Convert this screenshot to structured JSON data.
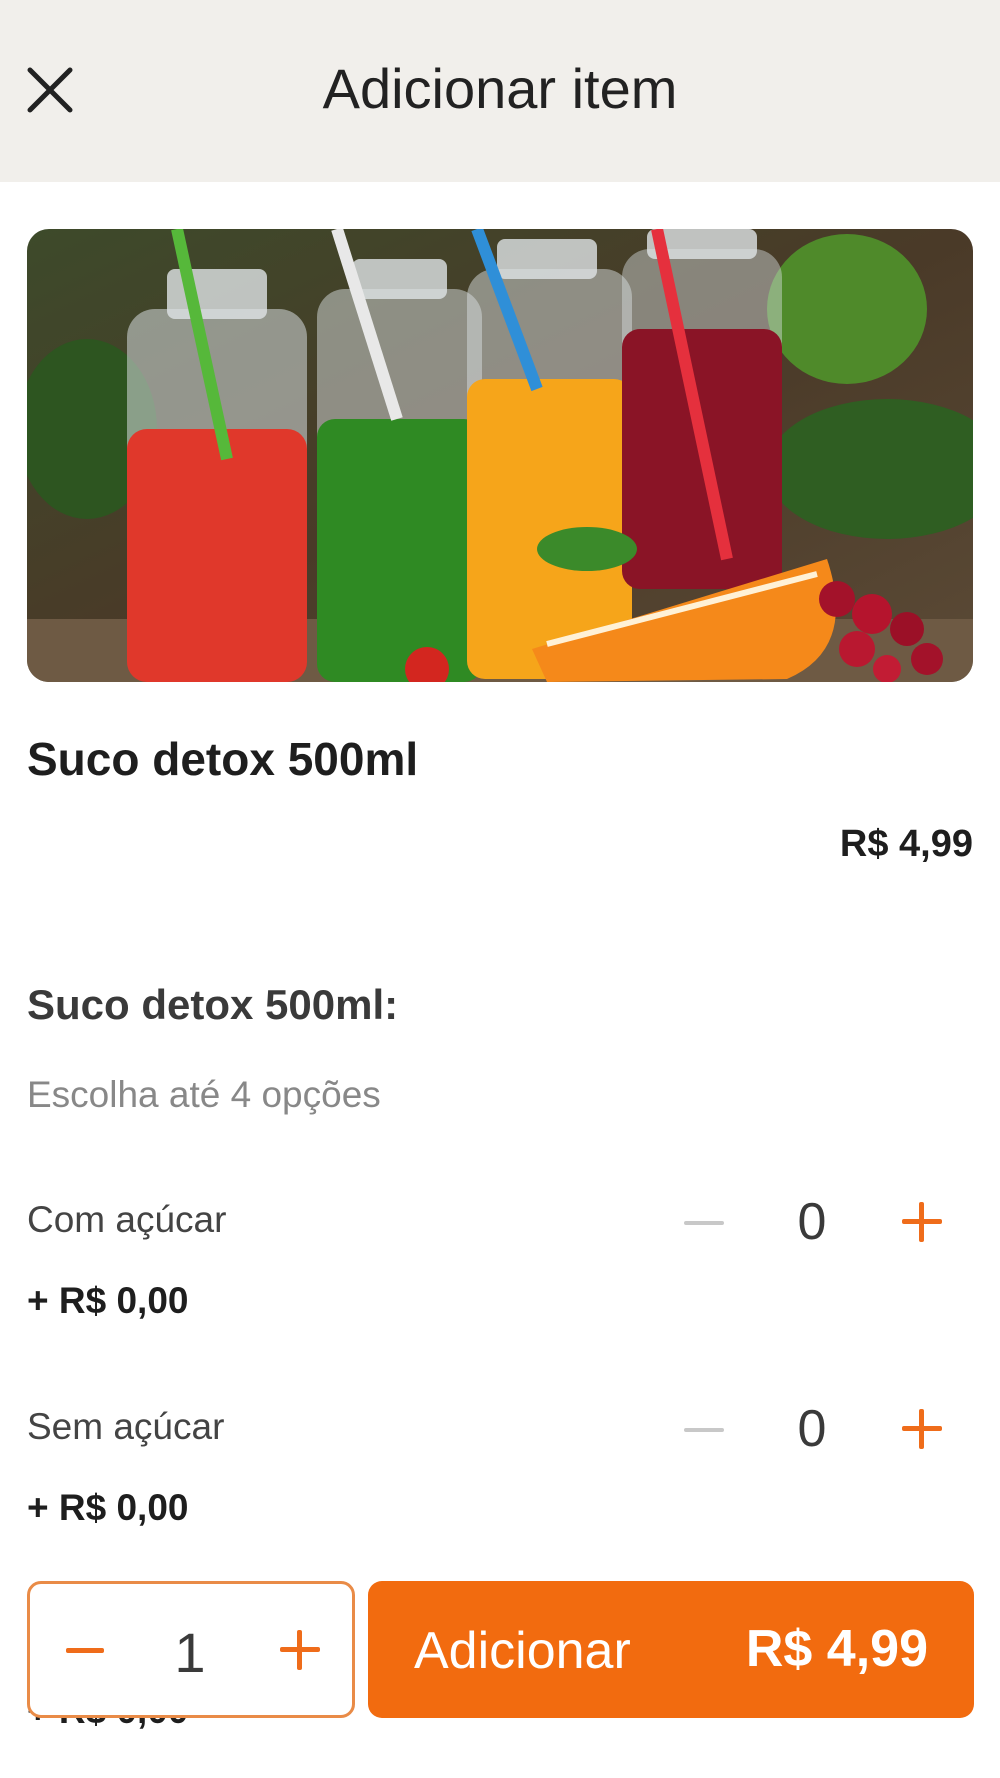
{
  "header": {
    "title": "Adicionar item",
    "close_icon": "close-icon"
  },
  "product": {
    "image_icon": "juice-bottles-photo",
    "name": "Suco detox 500ml",
    "price": "R$ 4,99"
  },
  "options_group": {
    "title": "Suco detox 500ml:",
    "hint": "Escolha até 4 opções",
    "items": [
      {
        "name": "Com açúcar",
        "price": "+ R$ 0,00",
        "count": "0"
      },
      {
        "name": "Sem açúcar",
        "price": "+ R$ 0,00",
        "count": "0"
      }
    ],
    "partial_next_price": "+ R$ 0,00"
  },
  "footer": {
    "quantity": "1",
    "add_label": "Adicionar",
    "add_total": "R$ 4,99"
  },
  "colors": {
    "accent": "#f26b0f",
    "header_bg": "#f1efeb"
  }
}
